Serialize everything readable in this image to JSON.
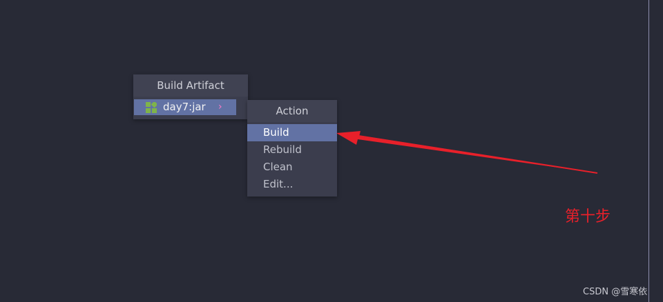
{
  "artifact_popup": {
    "title": "Build Artifact",
    "item": {
      "label": "day7:jar",
      "icon": "module-icon",
      "icon_color": "#7fb34a",
      "submenu_indicator": "›"
    }
  },
  "action_popup": {
    "title": "Action",
    "items": [
      "Build",
      "Rebuild",
      "Clean",
      "Edit..."
    ],
    "selected": "Build"
  },
  "annotation": {
    "text": "第十步",
    "color": "#e8202a"
  },
  "watermark": "CSDN @雪寒依",
  "colors": {
    "background": "#282a36",
    "popup": "#3b3d4d",
    "selection": "#6272a4"
  }
}
